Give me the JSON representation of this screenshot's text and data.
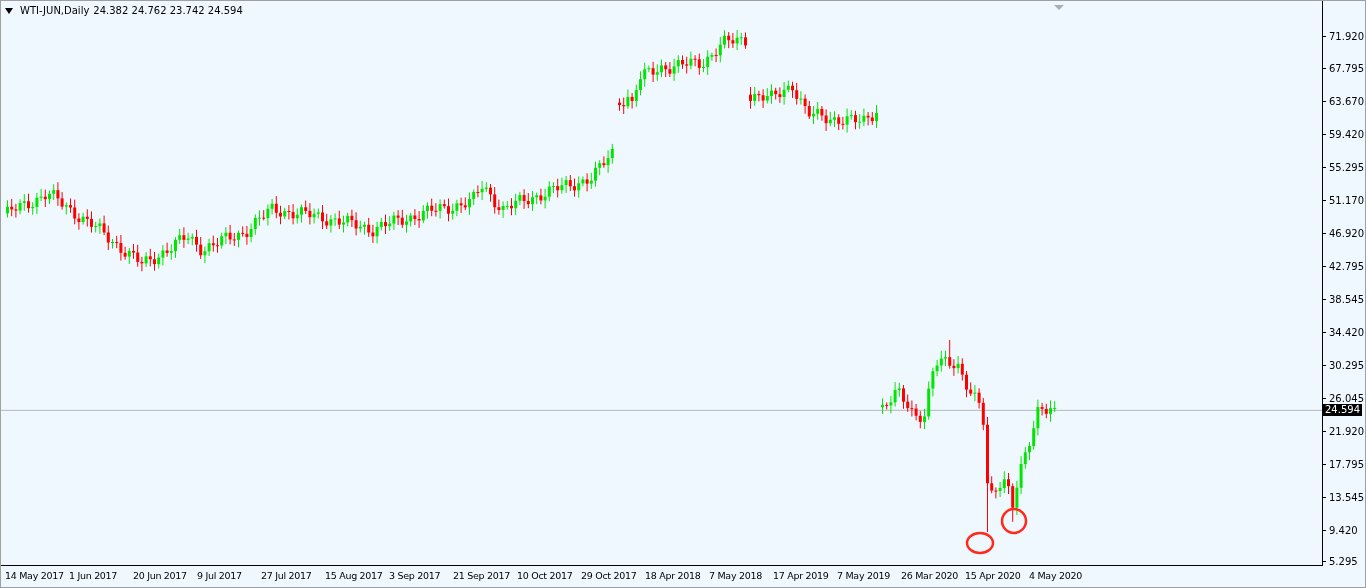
{
  "chart": {
    "symbol": "WTI-JUN,Daily",
    "ohlc": [
      "24.382",
      "24.762",
      "23.742",
      "24.594"
    ],
    "price_axis": [
      "71.920",
      "67.795",
      "63.670",
      "59.420",
      "55.295",
      "51.170",
      "46.920",
      "42.795",
      "38.545",
      "34.420",
      "30.295",
      "26.045",
      "21.920",
      "17.795",
      "13.545",
      "9.420",
      "5.295"
    ],
    "current_price": "24.594",
    "time_axis": [
      "14 May 2017",
      "1 Jun 2017",
      "20 Jun 2017",
      "9 Jul 2017",
      "27 Jul 2017",
      "15 Aug 2017",
      "3 Sep 2017",
      "21 Sep 2017",
      "10 Oct 2017",
      "29 Oct 2017",
      "18 Apr 2018",
      "7 May 2018",
      "17 Apr 2019",
      "7 May 2019",
      "26 Mar 2020",
      "15 Apr 2020",
      "4 May 2020"
    ]
  }
}
